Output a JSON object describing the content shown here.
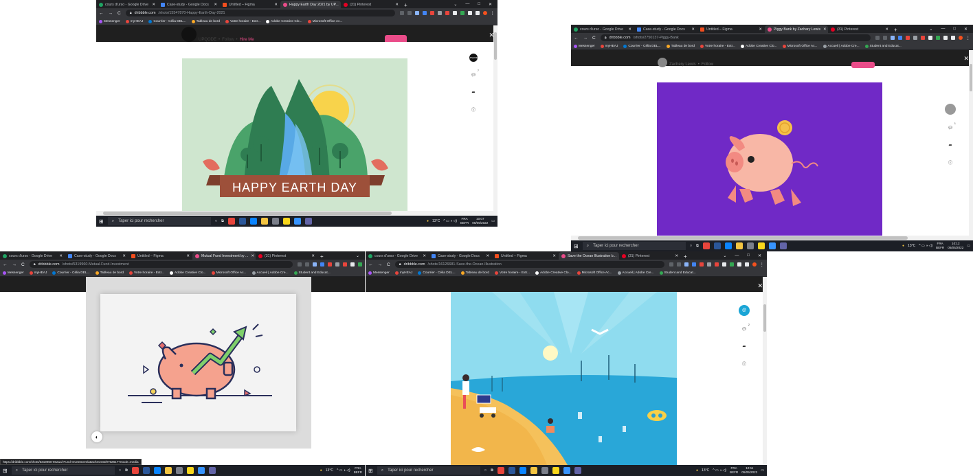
{
  "common": {
    "tabs": [
      "cours d'urso - Google Drive",
      "Case-study - Google Docs",
      "Untitled – Figma"
    ],
    "pinterest_tab": "(31) Pinterest",
    "bookmarks": [
      "Messenger",
      "myHEAJ",
      "Courrier - Célia DEL...",
      "Tableau de bord",
      "Votre horaire - Extr...",
      "Adobe Creative Clo...",
      "Microsoft Office Ac...",
      "Accueil | Adobe Cre...",
      "Student and Educat..."
    ],
    "domain": "dribbble.com",
    "taskbar_search": "Taper ici pour rechercher",
    "weather": "13°C",
    "lang_top": "FRA",
    "lang_bottom": "BEFR",
    "date": "05/05/2022",
    "win_controls": [
      "⌄",
      "—",
      "□",
      "✕"
    ],
    "colors": {
      "chrome_dark": "#202124",
      "chrome_tab": "#35363a",
      "taskbar": "#1c1f26",
      "dribbble_pink": "#ea4c89"
    }
  },
  "windows": [
    {
      "id": "earth-day",
      "active_tab": "Happy Earth Day 2021 by UP...",
      "path": "/shots/15547870-Happy-Earth-Day-2021",
      "time": "10:07",
      "author": "UPQODE",
      "follow": "Follow",
      "hire": "Hire Me",
      "avatar_text": "UPQODE",
      "comment_count": "7",
      "shot_text": "HAPPY EARTH DAY"
    },
    {
      "id": "piggy-bank",
      "active_tab": "Piggy Bank by Zachary Lewis",
      "path": "/shots/2750137-Piggy-Bank",
      "time": "10:12",
      "author": "Zachery Lewis",
      "follow": "Follow",
      "comment_count": "1"
    },
    {
      "id": "mutual-fund",
      "active_tab": "Mutual Fund Investment by ...",
      "path": "/shots/5319960-Mutual-Fund-Investment",
      "status_url": "https://dribbble.com/shots/5319960-Mutual-Fund-Investment/attachments/9762617?mode=media"
    },
    {
      "id": "save-ocean",
      "active_tab": "Save the Ocean Illustration b...",
      "path": "/shots/16126681-Save-the-Ocean-Illustration",
      "time": "10:11",
      "comment_count": "2"
    }
  ]
}
